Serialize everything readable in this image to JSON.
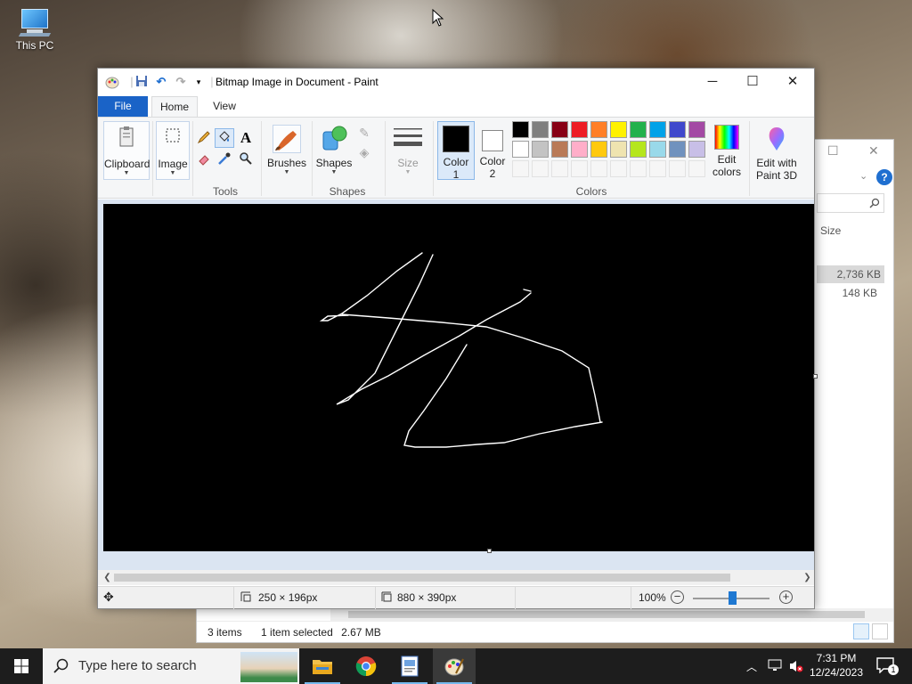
{
  "desktop": {
    "icon_label": "This PC"
  },
  "explorer": {
    "size_header": "Size",
    "rows": [
      "2,736 KB",
      "148 KB"
    ],
    "status": {
      "items": "3 items",
      "selected": "1 item selected",
      "size": "2.67 MB"
    }
  },
  "paint": {
    "title": "Bitmap Image in Document - Paint",
    "tabs": {
      "file": "File",
      "home": "Home",
      "view": "View"
    },
    "ribbon": {
      "clipboard": "Clipboard",
      "image": "Image",
      "tools_group": "Tools",
      "brushes": "Brushes",
      "shapes": "Shapes",
      "shapes_group": "Shapes",
      "size": "Size",
      "color1_line1": "Color",
      "color1_line2": "1",
      "color2_line1": "Color",
      "color2_line2": "2",
      "colors_group": "Colors",
      "edit_colors_line1": "Edit",
      "edit_colors_line2": "colors",
      "edit_paint3d_line1": "Edit with",
      "edit_paint3d_line2": "Paint 3D"
    },
    "palette_colors": [
      "#000000",
      "#7f7f7f",
      "#880015",
      "#ed1c24",
      "#ff7f27",
      "#fff200",
      "#22b14c",
      "#00a2e8",
      "#3f48cc",
      "#a349a4",
      "#ffffff",
      "#c3c3c3",
      "#b97a57",
      "#ffaec9",
      "#ffc90e",
      "#efe4b0",
      "#b5e61d",
      "#99d9ea",
      "#7092be",
      "#c8bfe7"
    ],
    "color1": "#000000",
    "color2": "#ffffff",
    "status": {
      "cursor_pos": "250 × 196px",
      "canvas_size": "880 × 390px",
      "zoom": "100%"
    }
  },
  "taskbar": {
    "search_placeholder": "Type here to search",
    "time": "7:31 PM",
    "date": "12/24/2023",
    "notification_count": "1"
  }
}
